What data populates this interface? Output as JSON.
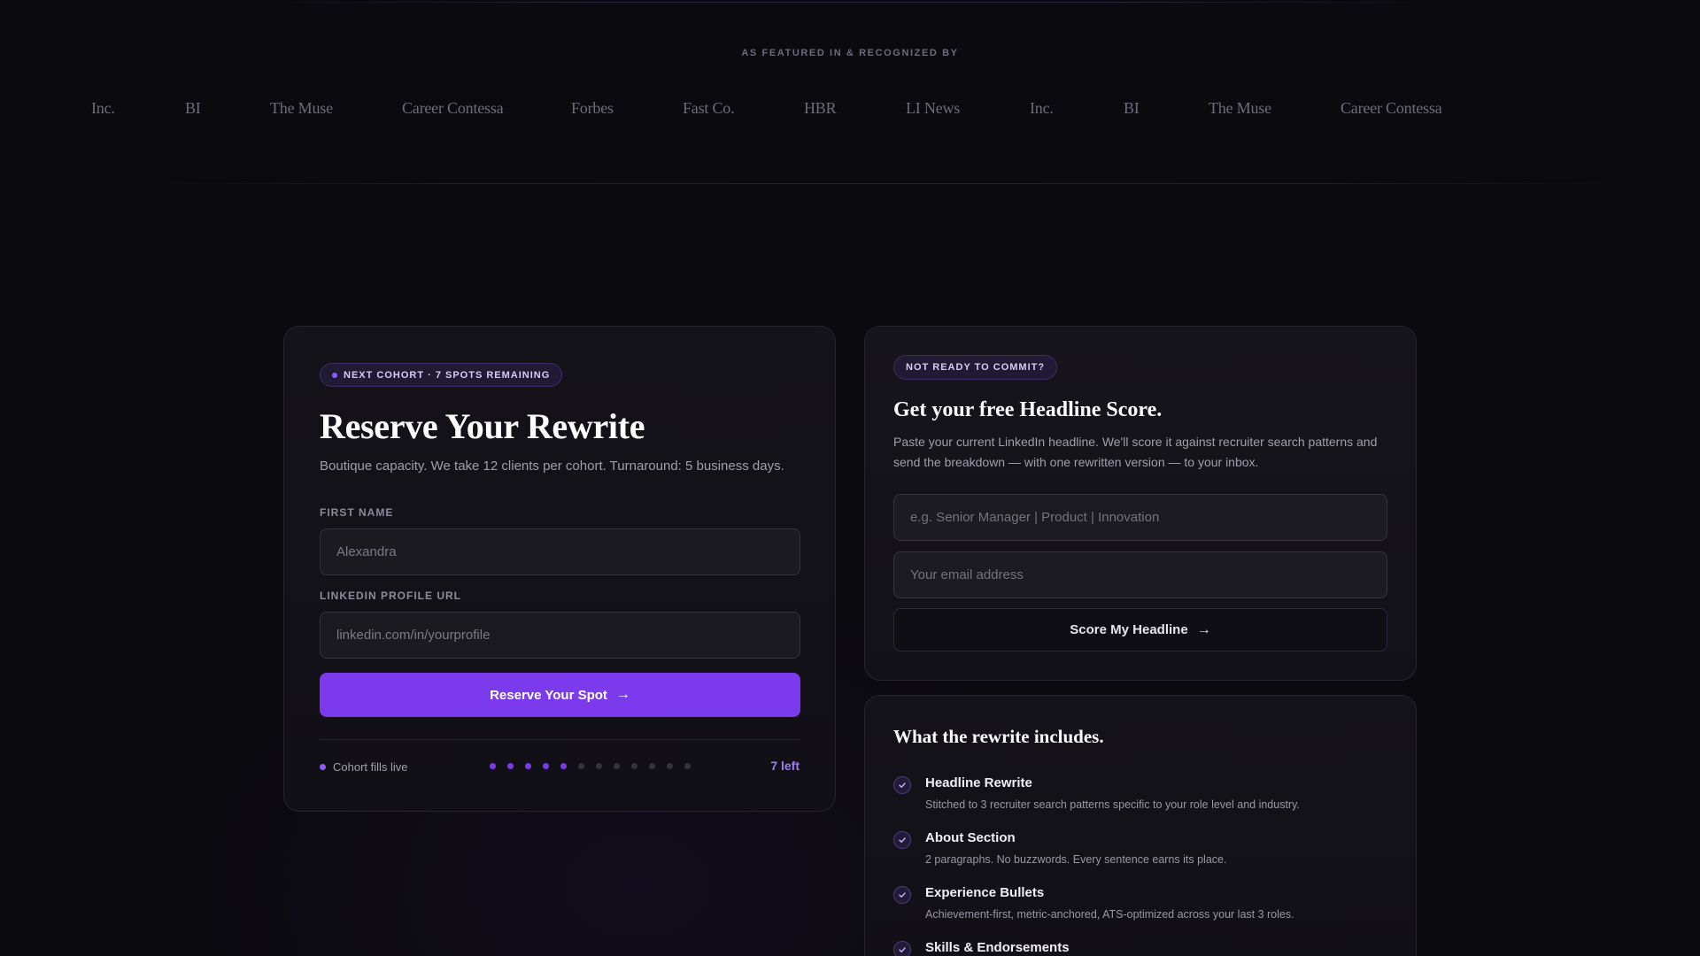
{
  "featured": {
    "label": "AS FEATURED IN & RECOGNIZED BY",
    "logos": [
      "Inc.",
      "BI",
      "The Muse",
      "Career Contessa",
      "Forbes",
      "Fast Co.",
      "HBR",
      "LI News",
      "Inc.",
      "BI",
      "The Muse",
      "Career Contessa"
    ]
  },
  "reserve": {
    "badge": "NEXT COHORT · 7 SPOTS REMAINING",
    "title": "Reserve Your Rewrite",
    "subtitle": "Boutique capacity. We take 12 clients per cohort. Turnaround: 5 business days.",
    "first_name_label": "FIRST NAME",
    "first_name_placeholder": "Alexandra",
    "linkedin_label": "LINKEDIN PROFILE URL",
    "linkedin_placeholder": "linkedin.com/in/yourprofile",
    "button_label": "Reserve Your Spot",
    "status_text": "Cohort fills live",
    "spots_total": 12,
    "spots_filled": 5,
    "spots_left_text": "7 left"
  },
  "headline_score": {
    "badge": "NOT READY TO COMMIT?",
    "title": "Get your free Headline Score.",
    "description": "Paste your current LinkedIn headline. We'll score it against recruiter search patterns and send the breakdown — with one rewritten version — to your inbox.",
    "headline_placeholder": "e.g. Senior Manager | Product | Innovation",
    "email_placeholder": "Your email address",
    "button_label": "Score My Headline"
  },
  "includes": {
    "title": "What the rewrite includes.",
    "items": [
      {
        "title": "Headline Rewrite",
        "description": "Stitched to 3 recruiter search patterns specific to your role level and industry."
      },
      {
        "title": "About Section",
        "description": "2 paragraphs. No buzzwords. Every sentence earns its place."
      },
      {
        "title": "Experience Bullets",
        "description": "Achievement-first, metric-anchored, ATS-optimized across your last 3 roles."
      },
      {
        "title": "Skills & Endorsements",
        "description": ""
      }
    ]
  },
  "colors": {
    "accent": "#7c3aed",
    "background": "#0b0a0f",
    "card": "#121117"
  }
}
